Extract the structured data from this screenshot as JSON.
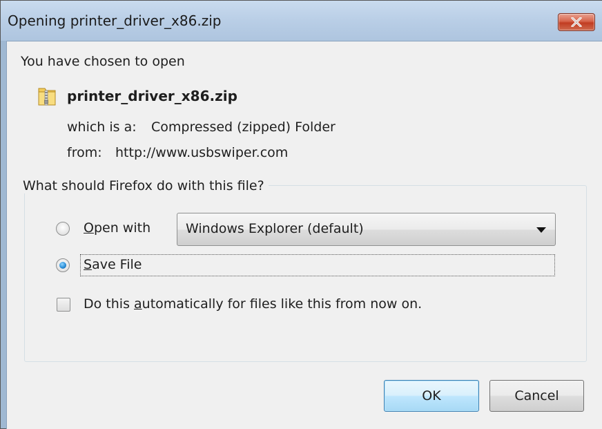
{
  "window": {
    "title": "Opening printer_driver_x86.zip"
  },
  "dialog": {
    "heading": "You have chosen to open",
    "filename": "printer_driver_x86.zip",
    "type_label": "which is a:",
    "type_value": "Compressed (zipped) Folder",
    "from_label": "from:",
    "from_value": "http://www.usbswiper.com"
  },
  "action_group": {
    "legend": "What should Firefox do with this file?",
    "open_with": {
      "accel": "O",
      "rest": "pen with",
      "checked": false,
      "selected_app": "Windows Explorer (default)"
    },
    "save_file": {
      "accel": "S",
      "rest": "ave File",
      "checked": true
    },
    "auto_checkbox": {
      "prefix": "Do this ",
      "accel": "a",
      "suffix": "utomatically for files like this from now on.",
      "checked": false
    }
  },
  "buttons": {
    "ok": "OK",
    "cancel": "Cancel"
  },
  "icons": {
    "file_icon": "zip-folder-icon",
    "close_icon": "close-icon",
    "dropdown_icon": "chevron-down-icon"
  },
  "colors": {
    "title_bar": "#b9cee6",
    "close_button": "#c13d22",
    "dialog_bg": "#f0f0f0",
    "radio_selected": "#2b8fd8"
  }
}
